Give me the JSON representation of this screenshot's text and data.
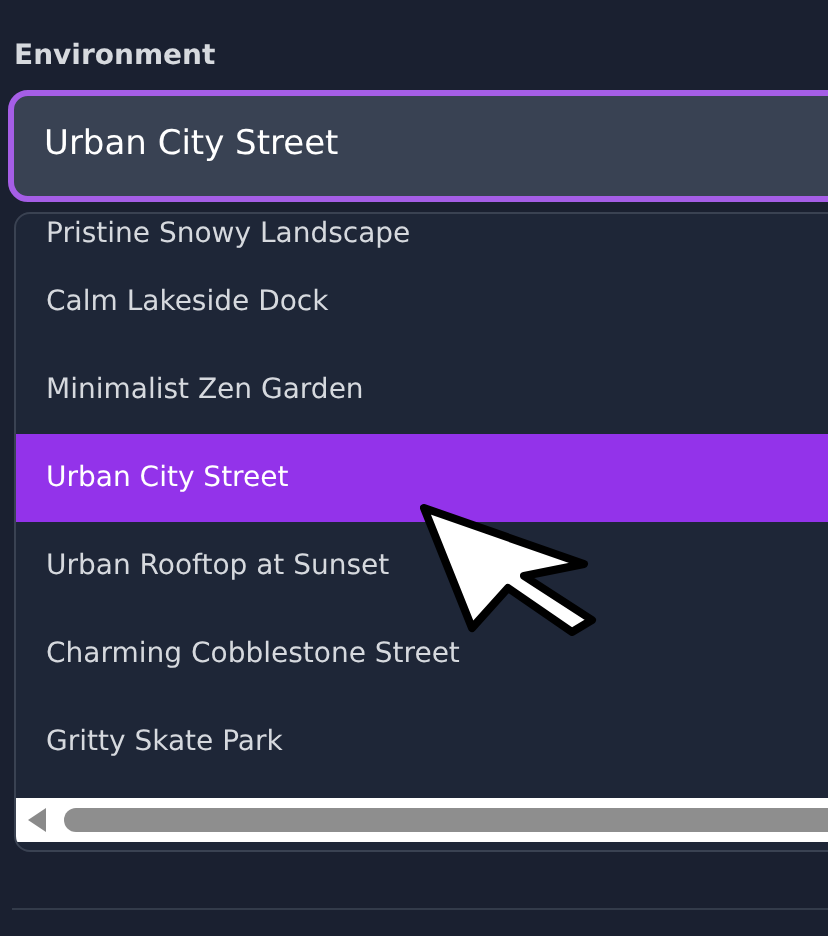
{
  "field_label": "Environment",
  "select": {
    "value": "Urban City Street"
  },
  "options": [
    {
      "label": "Pristine Snowy Landscape",
      "selected": false
    },
    {
      "label": "Calm Lakeside Dock",
      "selected": false
    },
    {
      "label": "Minimalist Zen Garden",
      "selected": false
    },
    {
      "label": "Urban City Street",
      "selected": true
    },
    {
      "label": "Urban Rooftop at Sunset",
      "selected": false
    },
    {
      "label": "Charming Cobblestone Street",
      "selected": false
    },
    {
      "label": "Gritty Skate Park",
      "selected": false
    }
  ]
}
